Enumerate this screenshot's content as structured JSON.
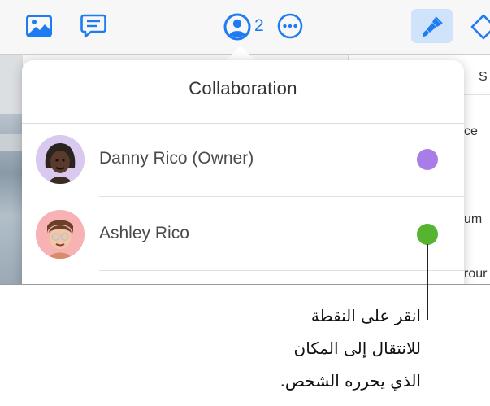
{
  "toolbar": {
    "collaborator_count": "2",
    "icons": [
      "media-icon",
      "comment-icon",
      "collaborate-icon",
      "more-icon",
      "format-icon",
      "shape-icon"
    ]
  },
  "inspector": {
    "partial_texts": [
      "S",
      "ce",
      "um",
      "rour"
    ]
  },
  "popover": {
    "title": "Collaboration",
    "participants": [
      {
        "name": "Danny Rico (Owner)",
        "color": "#a87de8"
      },
      {
        "name": "Ashley Rico",
        "color": "#55b531"
      }
    ]
  },
  "callout": {
    "lines": [
      "انقر على النقطة",
      "للانتقال إلى المكان",
      "الذي يحرره الشخص."
    ]
  },
  "colors": {
    "accent": "#1d7cf2",
    "format_button_bg": "#cfe3fb"
  }
}
